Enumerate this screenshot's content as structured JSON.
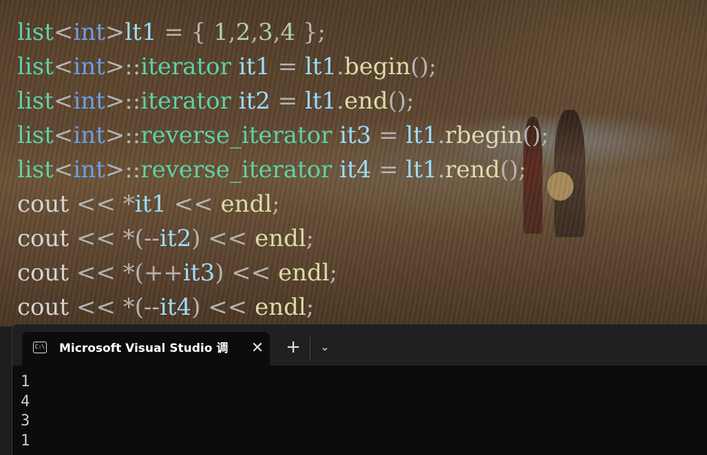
{
  "editor": {
    "lines": [
      [
        {
          "t": "list",
          "c": "kw"
        },
        {
          "t": "<",
          "c": "pn"
        },
        {
          "t": "int",
          "c": "ty"
        },
        {
          "t": ">",
          "c": "pn"
        },
        {
          "t": "lt1",
          "c": "vr"
        },
        {
          "t": " = { ",
          "c": "pn"
        },
        {
          "t": "1",
          "c": "nm"
        },
        {
          "t": ",",
          "c": "pn"
        },
        {
          "t": "2",
          "c": "nm"
        },
        {
          "t": ",",
          "c": "pn"
        },
        {
          "t": "3",
          "c": "nm"
        },
        {
          "t": ",",
          "c": "pn"
        },
        {
          "t": "4",
          "c": "nm"
        },
        {
          "t": " };",
          "c": "pn"
        }
      ],
      [
        {
          "t": "list",
          "c": "kw"
        },
        {
          "t": "<",
          "c": "pn"
        },
        {
          "t": "int",
          "c": "ty"
        },
        {
          "t": ">::",
          "c": "pn"
        },
        {
          "t": "iterator",
          "c": "it"
        },
        {
          "t": " ",
          "c": "tx"
        },
        {
          "t": "it1",
          "c": "vr"
        },
        {
          "t": " = ",
          "c": "pn"
        },
        {
          "t": "lt1",
          "c": "vr"
        },
        {
          "t": ".",
          "c": "pn"
        },
        {
          "t": "begin",
          "c": "fn"
        },
        {
          "t": "();",
          "c": "pn"
        }
      ],
      [
        {
          "t": "list",
          "c": "kw"
        },
        {
          "t": "<",
          "c": "pn"
        },
        {
          "t": "int",
          "c": "ty"
        },
        {
          "t": ">::",
          "c": "pn"
        },
        {
          "t": "iterator",
          "c": "it"
        },
        {
          "t": " ",
          "c": "tx"
        },
        {
          "t": "it2",
          "c": "vr"
        },
        {
          "t": " = ",
          "c": "pn"
        },
        {
          "t": "lt1",
          "c": "vr"
        },
        {
          "t": ".",
          "c": "pn"
        },
        {
          "t": "end",
          "c": "fn"
        },
        {
          "t": "();",
          "c": "pn"
        }
      ],
      [
        {
          "t": "list",
          "c": "kw"
        },
        {
          "t": "<",
          "c": "pn"
        },
        {
          "t": "int",
          "c": "ty"
        },
        {
          "t": ">::",
          "c": "pn"
        },
        {
          "t": "reverse_iterator",
          "c": "it"
        },
        {
          "t": " ",
          "c": "tx"
        },
        {
          "t": "it3",
          "c": "vr"
        },
        {
          "t": " = ",
          "c": "pn"
        },
        {
          "t": "lt1",
          "c": "vr"
        },
        {
          "t": ".",
          "c": "pn"
        },
        {
          "t": "rbegin",
          "c": "fn"
        },
        {
          "t": "();",
          "c": "pn"
        }
      ],
      [
        {
          "t": "list",
          "c": "kw"
        },
        {
          "t": "<",
          "c": "pn"
        },
        {
          "t": "int",
          "c": "ty"
        },
        {
          "t": ">::",
          "c": "pn"
        },
        {
          "t": "reverse_iterator",
          "c": "it"
        },
        {
          "t": " ",
          "c": "tx"
        },
        {
          "t": "it4",
          "c": "vr"
        },
        {
          "t": " = ",
          "c": "pn"
        },
        {
          "t": "lt1",
          "c": "vr"
        },
        {
          "t": ".",
          "c": "pn"
        },
        {
          "t": "rend",
          "c": "fn"
        },
        {
          "t": "();",
          "c": "pn"
        }
      ],
      [
        {
          "t": "cout",
          "c": "tx"
        },
        {
          "t": " << *",
          "c": "pn"
        },
        {
          "t": "it1",
          "c": "vr"
        },
        {
          "t": " << ",
          "c": "pn"
        },
        {
          "t": "endl",
          "c": "fn"
        },
        {
          "t": ";",
          "c": "pn"
        }
      ],
      [
        {
          "t": "cout",
          "c": "tx"
        },
        {
          "t": " << *(--",
          "c": "pn"
        },
        {
          "t": "it2",
          "c": "vr"
        },
        {
          "t": ") << ",
          "c": "pn"
        },
        {
          "t": "endl",
          "c": "fn"
        },
        {
          "t": ";",
          "c": "pn"
        }
      ],
      [
        {
          "t": "cout",
          "c": "tx"
        },
        {
          "t": " << *(++",
          "c": "pn"
        },
        {
          "t": "it3",
          "c": "vr"
        },
        {
          "t": ") << ",
          "c": "pn"
        },
        {
          "t": "endl",
          "c": "fn"
        },
        {
          "t": ";",
          "c": "pn"
        }
      ],
      [
        {
          "t": "cout",
          "c": "tx"
        },
        {
          "t": " << *(--",
          "c": "pn"
        },
        {
          "t": "it4",
          "c": "vr"
        },
        {
          "t": ") << ",
          "c": "pn"
        },
        {
          "t": "endl",
          "c": "fn"
        },
        {
          "t": ";",
          "c": "pn"
        }
      ]
    ]
  },
  "terminal": {
    "tab_icon_text": "C:\\",
    "tab_title": "Microsoft Visual Studio 调试控制台",
    "close_label": "✕",
    "new_tab_label": "+",
    "dropdown_label": "⌄",
    "output_lines": [
      "1",
      "4",
      "3",
      "1"
    ]
  }
}
